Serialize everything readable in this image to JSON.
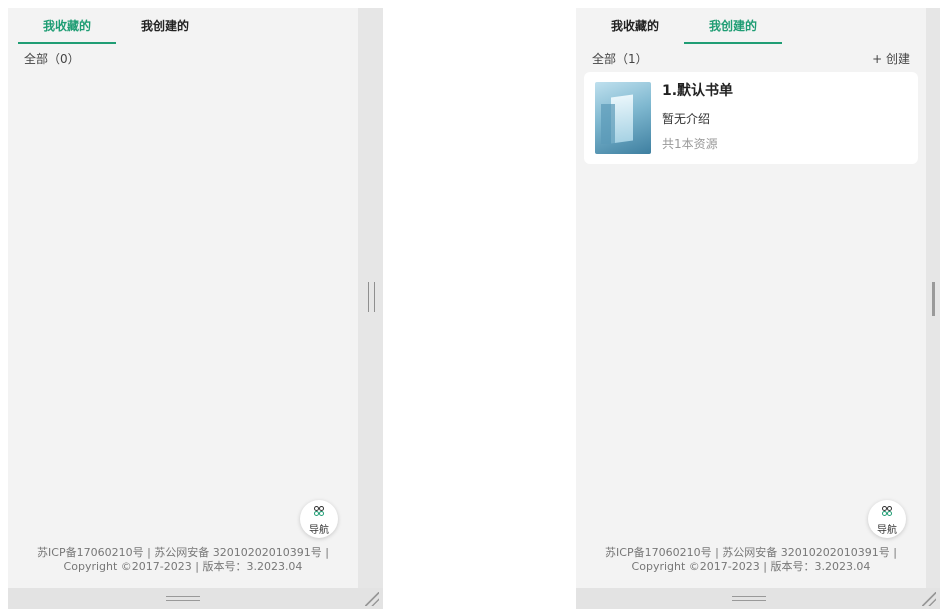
{
  "left_panel": {
    "tabs": [
      {
        "label": "我收藏的",
        "active": true
      },
      {
        "label": "我创建的",
        "active": false
      }
    ],
    "count_label": "全部（0）"
  },
  "right_panel": {
    "tabs": [
      {
        "label": "我收藏的",
        "active": false
      },
      {
        "label": "我创建的",
        "active": true
      }
    ],
    "count_label": "全部（1）",
    "create_label": "+ 创建",
    "books": [
      {
        "title": "1.默认书单",
        "description": "暂无介绍",
        "resource_count": "共1本资源"
      }
    ]
  },
  "nav_button": {
    "label": "导航",
    "icon": "grid-nav-icon"
  },
  "footer": {
    "line1": "苏ICP备17060210号 | 苏公网安备 32010202010391号 |",
    "line2": "Copyright ©2017-2023 | 版本号：3.2023.04"
  },
  "colors": {
    "accent": "#1f9d74",
    "panel_bg": "#f3f3f3",
    "card_bg": "#ffffff"
  }
}
